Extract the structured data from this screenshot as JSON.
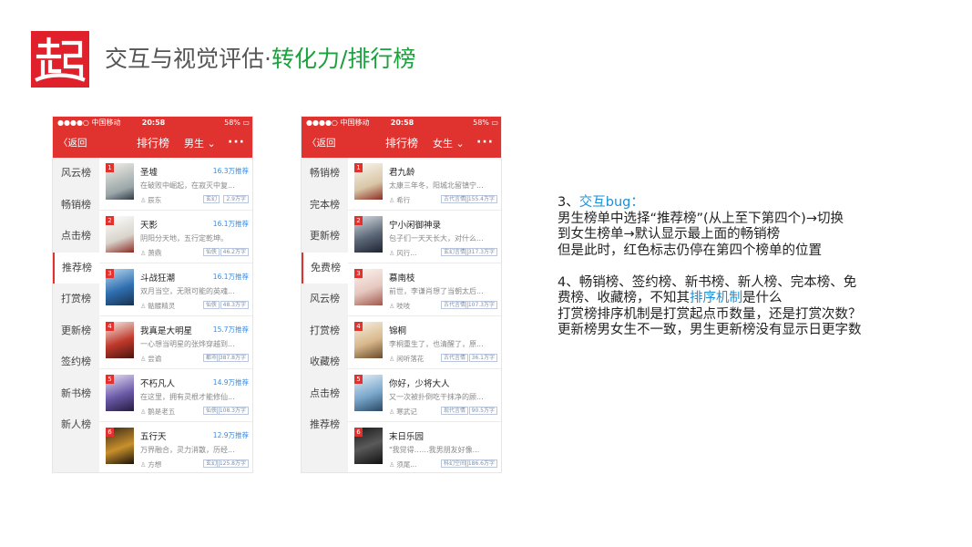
{
  "header": {
    "title_prefix": "交互与视觉评估·",
    "title_highlight": "转化力/排行榜",
    "logo_icon": "qidian-logo-icon",
    "brand_color": "#e0202a",
    "highlight_color": "#1aa23c"
  },
  "phone1": {
    "status": {
      "carrier": "●●●●○ 中国移动 ",
      "time": "20:58",
      "battery": "58% ▭"
    },
    "nav": {
      "back": "〈返回",
      "title": "排行榜",
      "gender": "男生 ⌄",
      "more": "···"
    },
    "sidebar": [
      "风云榜",
      "畅销榜",
      "点击榜",
      "推荐榜",
      "打赏榜",
      "更新榜",
      "签约榜",
      "新书榜",
      "新人榜"
    ],
    "active_index": 3,
    "books": [
      {
        "rank": "1",
        "name": "圣墟",
        "recommend": "16.3万推荐",
        "desc": "在破败中崛起，在寂灭中复...",
        "author": "辰东",
        "genre": "玄幻",
        "words": "2.9万字"
      },
      {
        "rank": "2",
        "name": "天影",
        "recommend": "16.1万推荐",
        "desc": "阴阳分天地，五行定乾坤。",
        "author": "萧鼎",
        "genre": "仙侠",
        "words": "46.2万字"
      },
      {
        "rank": "3",
        "name": "斗战狂潮",
        "recommend": "16.1万推荐",
        "desc": "双月当空，无限可能的英魂...",
        "author": "骷髅精灵",
        "genre": "仙侠",
        "words": "48.3万字"
      },
      {
        "rank": "4",
        "name": "我真是大明星",
        "recommend": "15.7万推荐",
        "desc": "一心想当明星的张烨穿越到...",
        "author": "尝谕",
        "genre": "都市",
        "words": "387.8万字"
      },
      {
        "rank": "5",
        "name": "不朽凡人",
        "recommend": "14.9万推荐",
        "desc": "在这里，拥有灵根才能修仙...",
        "author": "鹅是老五",
        "genre": "仙侠",
        "words": "108.3万字"
      },
      {
        "rank": "6",
        "name": "五行天",
        "recommend": "12.9万推荐",
        "desc": "万界融合，灵力消散，历经...",
        "author": "方想",
        "genre": "玄幻",
        "words": "125.8万字"
      }
    ]
  },
  "phone2": {
    "status": {
      "carrier": "●●●●○ 中国移动 ",
      "time": "20:58",
      "battery": "58% ▭"
    },
    "nav": {
      "back": "〈返回",
      "title": "排行榜",
      "gender": "女生 ⌄",
      "more": "···"
    },
    "sidebar": [
      "畅销榜",
      "完本榜",
      "更新榜",
      "免费榜",
      "风云榜",
      "打赏榜",
      "收藏榜",
      "点击榜",
      "推荐榜"
    ],
    "active_index": 3,
    "books": [
      {
        "rank": "1",
        "name": "君九龄",
        "desc": "太康三年冬，阳城北留镇宁...",
        "author": "希行",
        "genre": "古代言情",
        "words": "155.4万字"
      },
      {
        "rank": "2",
        "name": "宁小闲御神录",
        "desc": "包子们一天天长大，对什么...",
        "author": "风行...",
        "genre": "玄幻言情",
        "words": "317.3万字"
      },
      {
        "rank": "3",
        "name": "慕南枝",
        "desc": "前世，李谦肖想了当朝太后...",
        "author": "吱吱",
        "genre": "古代言情",
        "words": "107.3万字"
      },
      {
        "rank": "4",
        "name": "锦桐",
        "desc": "李桐重生了，也清醒了，原...",
        "author": "闲听落花",
        "genre": "古代言情",
        "words": "36.1万字"
      },
      {
        "rank": "5",
        "name": "你好，少将大人",
        "desc": "又一次被扑倒吃干抹净的顾...",
        "author": "寒武记",
        "genre": "现代言情",
        "words": "90.5万字"
      },
      {
        "rank": "6",
        "name": "末日乐园",
        "desc": "\"我觉得……我男朋友好像...",
        "author": "须尾...",
        "genre": "科幻空间",
        "words": "186.6万字"
      }
    ]
  },
  "notes": {
    "item3_num": "3、",
    "item3_label": "交互bug：",
    "item3_lines": [
      "男生榜单中选择“推荐榜”(从上至下第四个)→切换",
      "到女生榜单→默认显示最上面的畅销榜",
      "但是此时，红色标志仍停在第四个榜单的位置"
    ],
    "item4_line1": "4、畅销榜、签约榜、新书榜、新人榜、完本榜、免",
    "item4_line2_pre": "费榜、收藏榜，不知其",
    "item4_line2_hl": "排序机制",
    "item4_line2_post": "是什么",
    "item4_line3": "打赏榜排序机制是打赏起点币数量，还是打赏次数？",
    "item4_line4": "更新榜男女生不一致，男生更新榜没有显示日更字数",
    "accent_color": "#1e8fd6"
  }
}
